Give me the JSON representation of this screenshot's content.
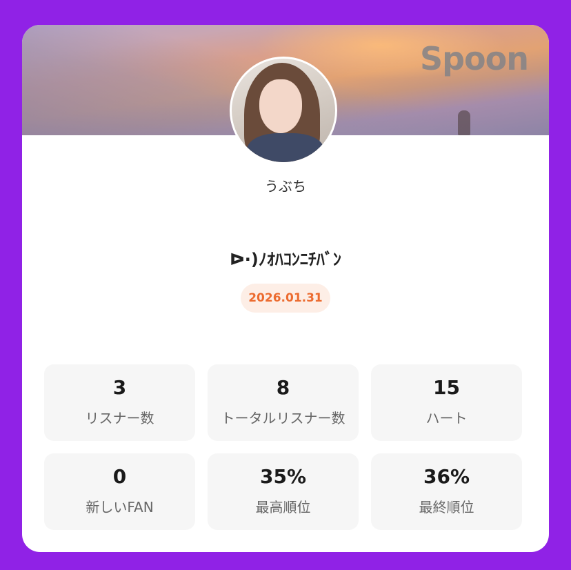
{
  "banner": {
    "brand": "Spoon"
  },
  "profile": {
    "username": "うぶち"
  },
  "broadcast": {
    "title": "ᐅ·)ﾉｵﾊｺﾝﾆﾁﾊﾞﾝ",
    "date": "2026.01.31"
  },
  "stats": [
    {
      "value": "3",
      "label": "リスナー数"
    },
    {
      "value": "8",
      "label": "トータルリスナー数"
    },
    {
      "value": "15",
      "label": "ハート"
    },
    {
      "value": "0",
      "label": "新しいFAN"
    },
    {
      "value": "35%",
      "label": "最高順位"
    },
    {
      "value": "36%",
      "label": "最終順位"
    }
  ],
  "colors": {
    "background": "#9022e6",
    "card": "#ffffff",
    "date_badge_bg": "#fdeee6",
    "date_badge_text": "#ec6b2f",
    "stat_tile": "#f6f6f6"
  }
}
